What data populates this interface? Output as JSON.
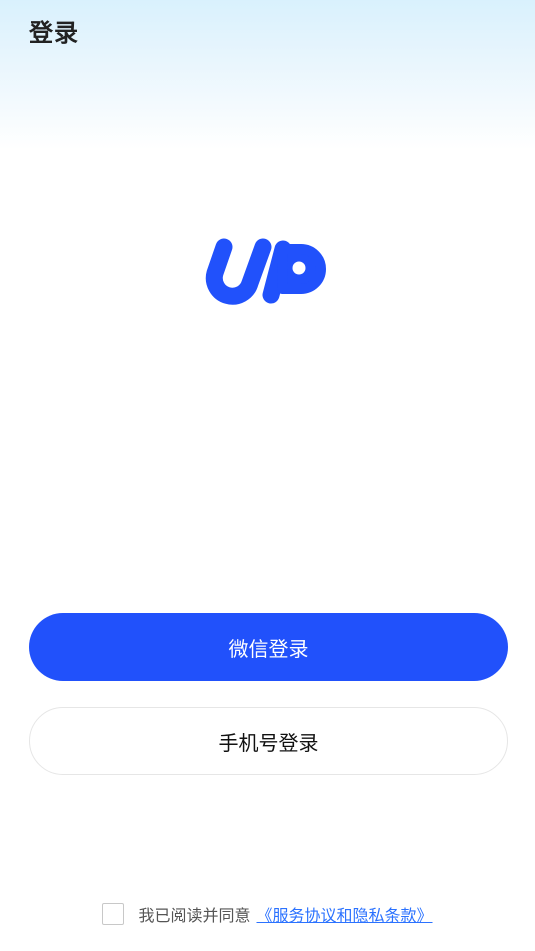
{
  "header": {
    "title": "登录"
  },
  "brand": {
    "logo_text": "UP",
    "logo_color": "#2151fb"
  },
  "actions": {
    "wechat_login_label": "微信登录",
    "phone_login_label": "手机号登录"
  },
  "agreement": {
    "checked": false,
    "text": "我已阅读并同意",
    "link_text": "《服务协议和隐私条款》"
  },
  "colors": {
    "primary": "#2151fb",
    "link": "#2b72ff",
    "header_gradient_top": "#d9f1fd"
  }
}
